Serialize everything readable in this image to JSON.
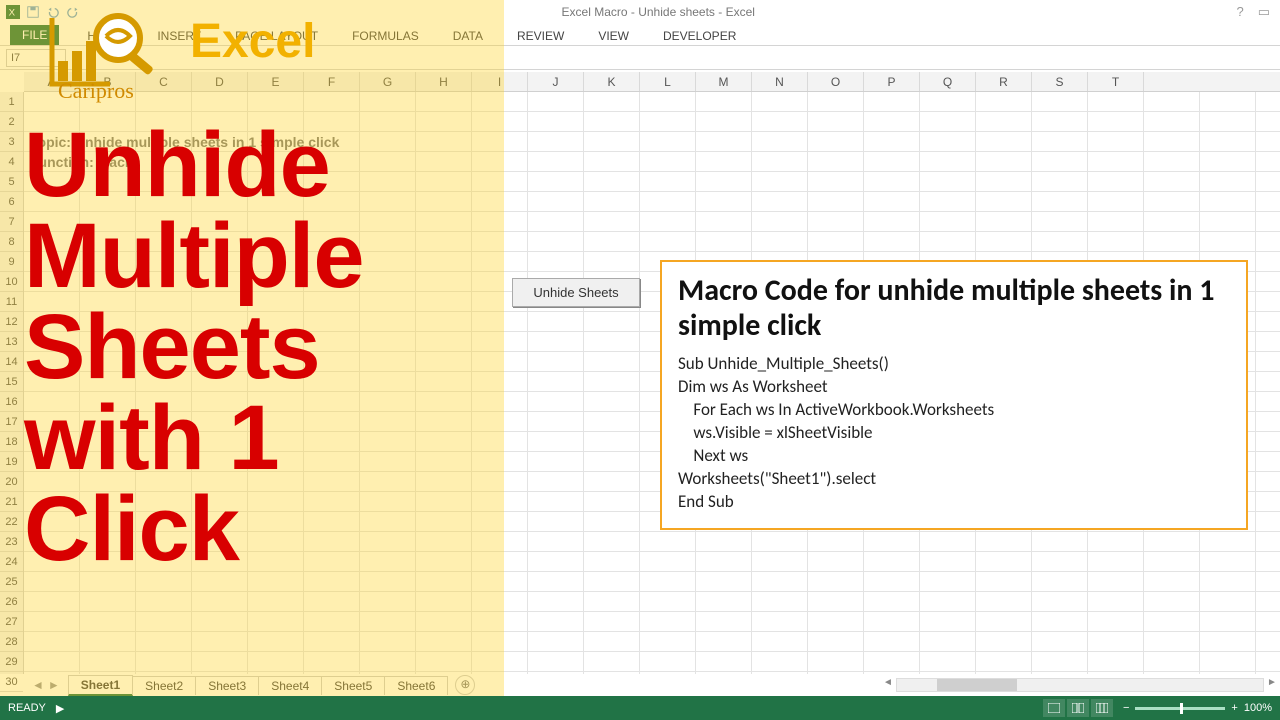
{
  "window": {
    "title": "Excel Macro - Unhide sheets - Excel",
    "help": "?",
    "rib_opts": "▭"
  },
  "ribbon": {
    "file": "FILE",
    "tabs": [
      "HOME",
      "INSERT",
      "PAGE LAYOUT",
      "FORMULAS",
      "DATA",
      "REVIEW",
      "VIEW",
      "DEVELOPER"
    ]
  },
  "namebox": "I7",
  "columns": [
    "A",
    "B",
    "C",
    "D",
    "E",
    "F",
    "G",
    "H",
    "I",
    "J",
    "K",
    "L",
    "M",
    "N",
    "O",
    "P",
    "Q",
    "R",
    "S",
    "T"
  ],
  "rows_count": 30,
  "ghost": {
    "topic": "Topic: Unhide multiple sheets in 1 simple click",
    "func": "Function: Macro"
  },
  "macro_button_label": "Unhide Sheets",
  "code_panel": {
    "title": "Macro Code for unhide multiple sheets in 1 simple click",
    "body": "Sub Unhide_Multiple_Sheets()\nDim ws As Worksheet\n    For Each ws In ActiveWorkbook.Worksheets\n    ws.Visible = xlSheetVisible\n    Next ws\nWorksheets(\"Sheet1\").select\nEnd Sub"
  },
  "sheets": [
    "Sheet1",
    "Sheet2",
    "Sheet3",
    "Sheet4",
    "Sheet5",
    "Sheet6"
  ],
  "new_sheet": "⊕",
  "status": {
    "ready": "READY",
    "macro_ind": "▶",
    "zoom": "100%",
    "minus": "−",
    "plus": "+"
  },
  "overlay": {
    "brand": "Excel",
    "sub": "Caripros",
    "headline_lines": [
      "Unhide",
      "Multiple",
      "Sheets",
      "with 1",
      "Click"
    ]
  }
}
